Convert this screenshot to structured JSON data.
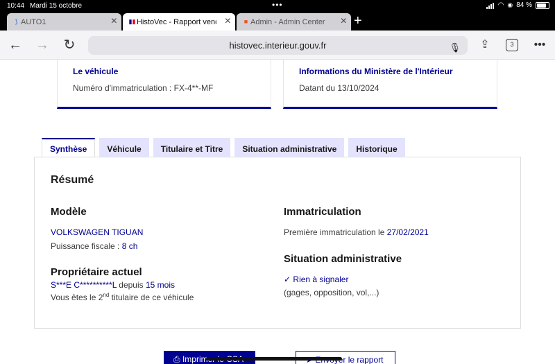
{
  "status_bar": {
    "time": "10:44",
    "date": "Mardi 15 octobre",
    "battery": "84 %"
  },
  "browser_tabs": [
    {
      "label": "AUTO1"
    },
    {
      "label": "HistoVec - Rapport vende"
    },
    {
      "label": "Admin - Admin Center"
    }
  ],
  "toolbar": {
    "url": "histovec.interieur.gouv.fr",
    "tab_count": "3"
  },
  "cards": {
    "vehicle": {
      "title": "Le véhicule",
      "text": "Numéro d'immatriculation : FX-4**-MF"
    },
    "ministry": {
      "title": "Informations du Ministère de l'Intérieur",
      "text": "Datant du 13/10/2024"
    }
  },
  "page_tabs": [
    "Synthèse",
    "Véhicule",
    "Titulaire et Titre",
    "Situation administrative",
    "Historique"
  ],
  "summary": {
    "title": "Résumé",
    "model_heading": "Modèle",
    "model_value": "VOLKSWAGEN TIGUAN",
    "power_label": "Puissance fiscale : ",
    "power_value": "8 ch",
    "owner_heading": "Propriétaire actuel",
    "owner_name": "S***E C**********L",
    "owner_since_label": " depuis ",
    "owner_since_value": "15 mois",
    "owner_rank_before": "Vous êtes le 2",
    "owner_rank_sup": "nd",
    "owner_rank_after": " titulaire de ce véhicule",
    "registration_heading": "Immatriculation",
    "registration_label": "Première immatriculation le ",
    "registration_date": "27/02/2021",
    "admin_heading": "Situation administrative",
    "admin_status": "Rien à signaler",
    "admin_note": "(gages, opposition, vol,...)"
  },
  "buttons": {
    "print": "Imprimer le CSA",
    "send": "Envoyer le rapport"
  },
  "colors": {
    "primary": "#000091",
    "tab_bg": "#e3e3fd"
  }
}
